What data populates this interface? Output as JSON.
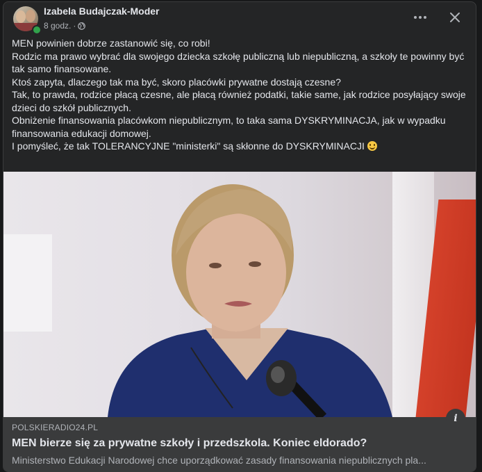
{
  "post": {
    "author": "Izabela Budajczak-Moder",
    "time": "8 godz.",
    "separator": "·",
    "privacy_icon": "globe-icon",
    "lines": [
      "MEN powinien dobrze zastanowić się, co robi!",
      "Rodzic ma prawo wybrać dla swojego dziecka szkołę publiczną lub niepubliczną, a szkoły te powinny być tak samo finansowane.",
      "Ktoś zapyta, dlaczego tak ma być, skoro placówki prywatne dostają czesne?",
      "Tak, to prawda, rodzice płacą czesne, ale płacą również podatki, takie same, jak rodzice posyłający swoje dzieci do szkół publicznych.",
      "Obniżenie finansowania placówkom niepublicznym, to taka sama DYSKRYMINACJA, jak w wypadku finansowania edukacji domowej.",
      "I pomyśleć, że tak TOLERANCYJNE \"ministerki\" są skłonne do DYSKRYMINACJI"
    ],
    "last_line_emoji": "smiling-face-emoji"
  },
  "link": {
    "domain": "POLSKIERADIO24.PL",
    "title": "MEN bierze się za prywatne szkoły i przedszkola. Koniec eldorado?",
    "description": "Ministerstwo Edukacji Narodowej chce uporządkować zasady finansowania niepublicznych pla..."
  },
  "colors": {
    "background": "#18191a",
    "card": "#242526",
    "link_panel": "#3a3b3c",
    "text_primary": "#e4e6eb",
    "text_secondary": "#b0b3b8",
    "online": "#31a24c"
  }
}
